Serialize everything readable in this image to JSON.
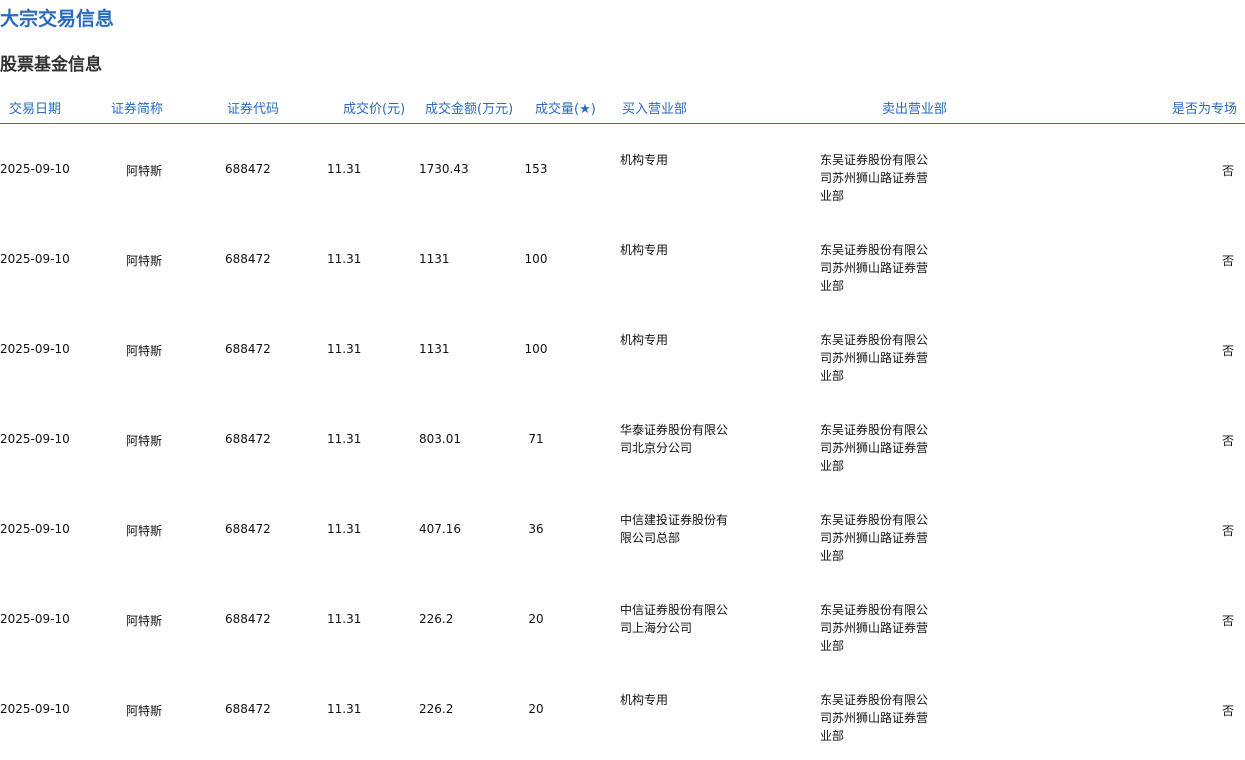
{
  "page": {
    "title": "大宗交易信息",
    "section_title": "股票基金信息"
  },
  "table": {
    "headers": {
      "date": "交易日期",
      "name": "证券简称",
      "code": "证券代码",
      "price": "成交价(元)",
      "amount": "成交金额(万元)",
      "volume": "成交量(★)",
      "buyer": "买入营业部",
      "seller": "卖出营业部",
      "special": "是否为专场"
    },
    "rows": [
      {
        "date": "2025-09-10",
        "name": "阿特斯",
        "code": "688472",
        "price": "11.31",
        "amount": "1730.43",
        "volume": "153",
        "buyer": "机构专用",
        "seller": "东吴证券股份有限公司苏州狮山路证券营业部",
        "special": "否"
      },
      {
        "date": "2025-09-10",
        "name": "阿特斯",
        "code": "688472",
        "price": "11.31",
        "amount": "1131",
        "volume": "100",
        "buyer": "机构专用",
        "seller": "东吴证券股份有限公司苏州狮山路证券营业部",
        "special": "否"
      },
      {
        "date": "2025-09-10",
        "name": "阿特斯",
        "code": "688472",
        "price": "11.31",
        "amount": "1131",
        "volume": "100",
        "buyer": "机构专用",
        "seller": "东吴证券股份有限公司苏州狮山路证券营业部",
        "special": "否"
      },
      {
        "date": "2025-09-10",
        "name": "阿特斯",
        "code": "688472",
        "price": "11.31",
        "amount": "803.01",
        "volume": "71",
        "buyer": "华泰证券股份有限公司北京分公司",
        "seller": "东吴证券股份有限公司苏州狮山路证券营业部",
        "special": "否"
      },
      {
        "date": "2025-09-10",
        "name": "阿特斯",
        "code": "688472",
        "price": "11.31",
        "amount": "407.16",
        "volume": "36",
        "buyer": "中信建投证券股份有限公司总部",
        "seller": "东吴证券股份有限公司苏州狮山路证券营业部",
        "special": "否"
      },
      {
        "date": "2025-09-10",
        "name": "阿特斯",
        "code": "688472",
        "price": "11.31",
        "amount": "226.2",
        "volume": "20",
        "buyer": "中信证券股份有限公司上海分公司",
        "seller": "东吴证券股份有限公司苏州狮山路证券营业部",
        "special": "否"
      },
      {
        "date": "2025-09-10",
        "name": "阿特斯",
        "code": "688472",
        "price": "11.31",
        "amount": "226.2",
        "volume": "20",
        "buyer": "机构专用",
        "seller": "东吴证券股份有限公司苏州狮山路证券营业部",
        "special": "否"
      }
    ]
  }
}
